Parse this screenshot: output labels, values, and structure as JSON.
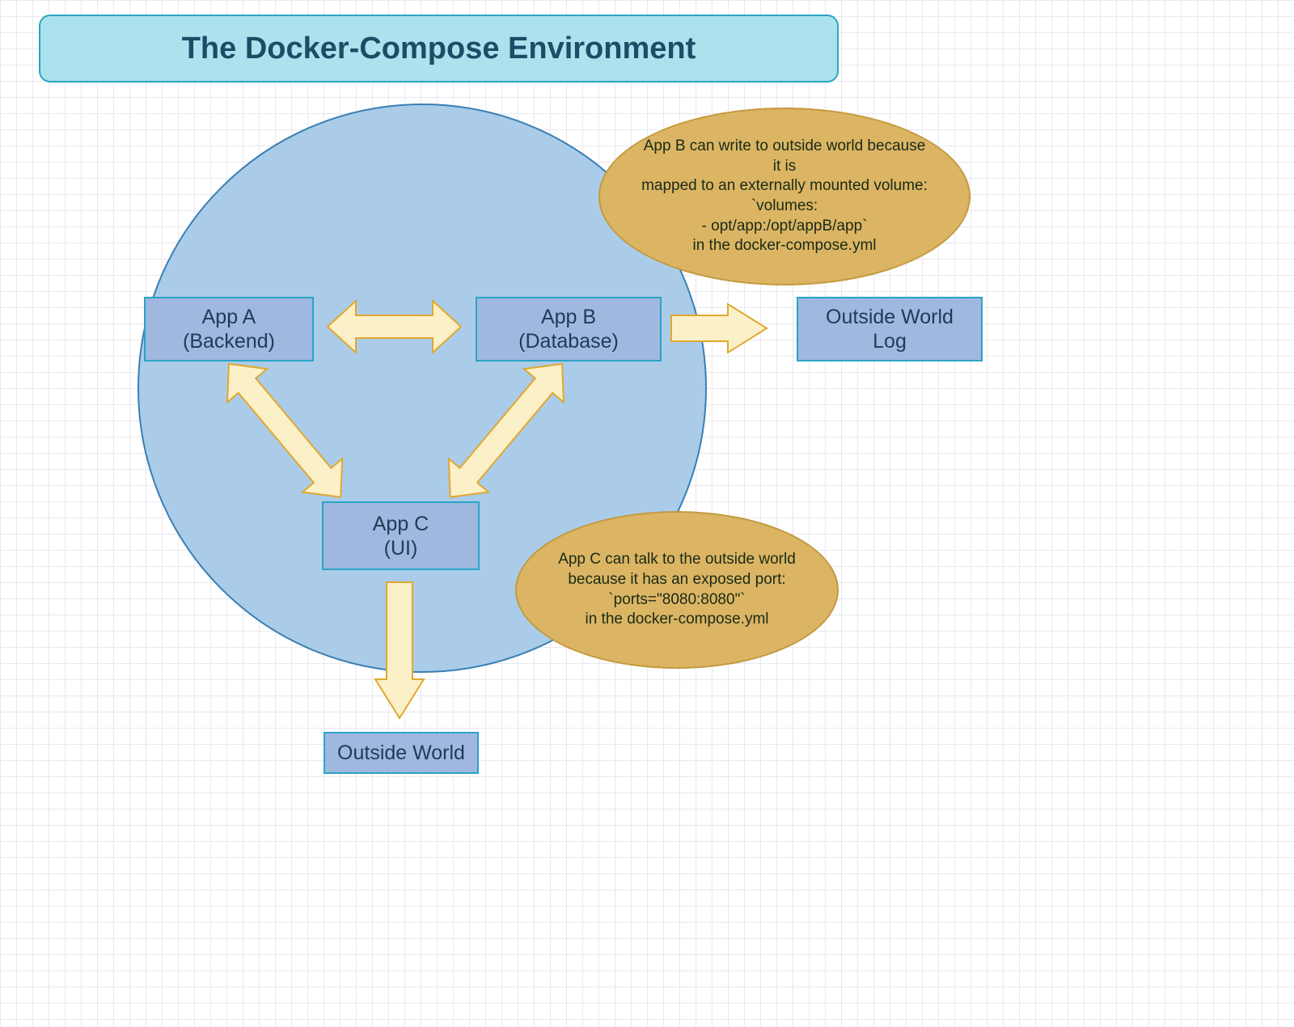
{
  "title": "The Docker-Compose Environment",
  "nodes": {
    "appA": "App A\n(Backend)",
    "appB": "App B\n(Database)",
    "appC": "App C\n(UI)",
    "outsideWorldLog": "Outside World\nLog",
    "outsideWorld": "Outside World"
  },
  "callouts": {
    "appB": "App B can write to outside world because it is\nmapped to an externally mounted volume:\n`volumes:\n- opt/app:/opt/appB/app`\nin the docker-compose.yml",
    "appC": "App C can talk to the outside world\nbecause it has an exposed port:\n`ports=\"8080:8080\"`\nin the docker-compose.yml"
  },
  "colors": {
    "titleBg": "#ace2ed",
    "titleBorder": "#2aa4c4",
    "circleBg": "#aacce9",
    "circleBorder": "#3a7fb5",
    "boxBg": "#a0b8e0",
    "boxBorder": "#2aa4c4",
    "calloutBg": "#dbb564",
    "calloutBorder": "#c49a3f",
    "arrowFill": "#fcf0c8",
    "arrowStroke": "#e0a830",
    "textDark": "#1a4d66"
  }
}
